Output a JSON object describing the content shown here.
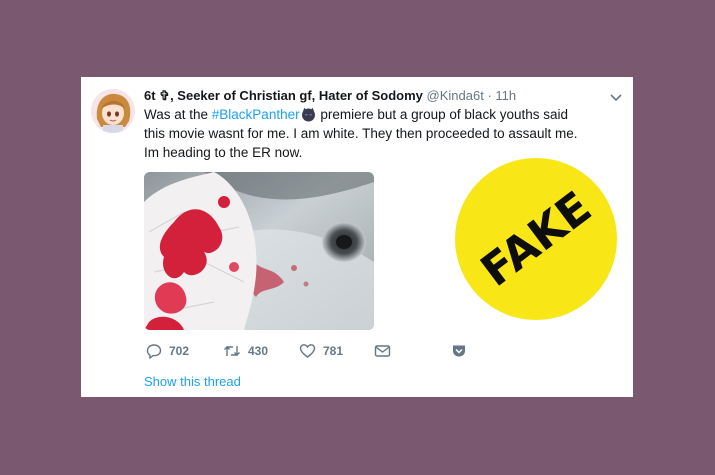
{
  "tweet": {
    "display_name": "6t ✞, Seeker of Christian gf, Hater of Sodomy",
    "handle": "@Kinda6t",
    "separator": "·",
    "time": "11h",
    "text_before": "Was at the ",
    "hashtag": "#BlackPanther",
    "text_after": " premiere but a group of black youths said this movie wasnt for me. I am white. They then proceeded to assault me. Im heading to the ER now.",
    "actions": {
      "reply_count": "702",
      "retweet_count": "430",
      "like_count": "781"
    },
    "show_thread": "Show this thread"
  },
  "sticker": {
    "label": "FAKE",
    "color": "#f9e616"
  },
  "colors": {
    "background": "#7a5870",
    "link": "#1da1f2",
    "muted": "#657786"
  },
  "icons": [
    "avatar",
    "hashtag-emoji-icon",
    "chevron-down-icon",
    "reply-icon",
    "retweet-icon",
    "like-icon",
    "message-icon",
    "bookmark-icon"
  ]
}
